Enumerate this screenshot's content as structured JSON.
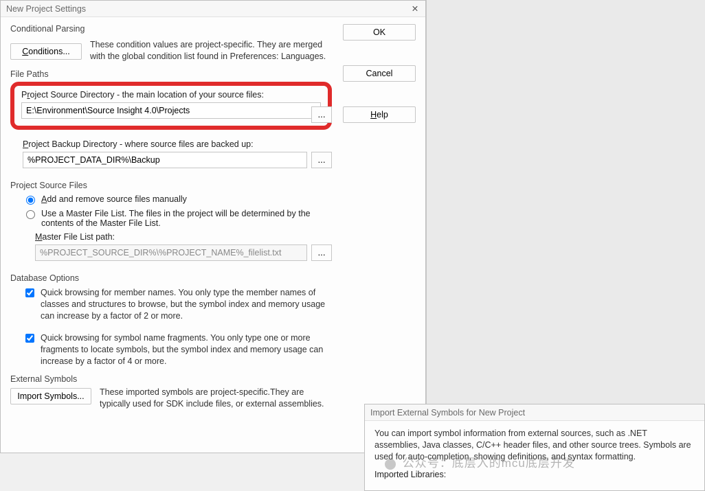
{
  "dialog": {
    "title": "New Project Settings",
    "close_icon": "✕",
    "buttons": {
      "ok": "OK",
      "cancel": "Cancel",
      "help": "Help"
    },
    "conditional_parsing": {
      "label": "Conditional Parsing",
      "conditions_btn": "Conditions...",
      "desc": "These condition values are project-specific.  They are merged with the global condition list found in Preferences: Languages."
    },
    "file_paths": {
      "label": "File Paths",
      "src_dir_label": "Project Source Directory - the main location of your source files:",
      "src_dir_value": "E:\\Environment\\Source Insight 4.0\\Projects",
      "browse": "...",
      "backup_label": "Project Backup Directory - where source files are backed up:",
      "backup_value": "%PROJECT_DATA_DIR%\\Backup"
    },
    "source_files": {
      "label": "Project Source Files",
      "opt_manual": "Add and remove source files manually",
      "opt_master": "Use a Master File List. The files in the project will be determined by the contents of the Master File List.",
      "master_path_label": "Master File List path:",
      "master_path_value": "%PROJECT_SOURCE_DIR%\\%PROJECT_NAME%_filelist.txt"
    },
    "db_options": {
      "label": "Database Options",
      "opt1": "Quick browsing for member names.  You only type the member names of classes and structures to browse, but the symbol index and memory usage can increase by a factor of 2 or more.",
      "opt2": "Quick browsing for symbol name fragments.  You only type one or more fragments to locate symbols, but the symbol index and memory usage can increase by a factor of 4 or more."
    },
    "external": {
      "label": "External Symbols",
      "import_btn": "Import Symbols...",
      "desc": "These imported symbols are project-specific.They are typically used for SDK include files, or external assemblies."
    }
  },
  "dialog2": {
    "title": "Import External Symbols for New Project",
    "desc": "You can import symbol information from external sources, such as .NET assemblies, Java classes, C/C++ header files, and other source trees. Symbols are used for auto-completion, showing definitions, and syntax formatting.",
    "imported_label": "Imported Libraries:"
  },
  "watermark": "公众号：底层入的mcu底层开发"
}
